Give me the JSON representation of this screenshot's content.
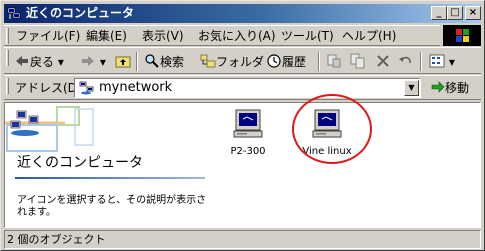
{
  "window": {
    "title": "近くのコンピュータ",
    "minimize": "_",
    "maximize": "□",
    "close": "×"
  },
  "menu": [
    {
      "label": "ファイル(F)"
    },
    {
      "label": "編集(E)"
    },
    {
      "label": "表示(V)"
    },
    {
      "label": "お気に入り(A)"
    },
    {
      "label": "ツール(T)"
    },
    {
      "label": "ヘルプ(H)"
    }
  ],
  "toolbar": {
    "back": "戻る",
    "search": "検索",
    "folders": "フォルダ",
    "history": "履歴"
  },
  "address": {
    "label": "アドレス(D)",
    "value": "mynetwork",
    "go": "移動"
  },
  "banner": {
    "title": "近くのコンピュータ",
    "description": "アイコンを選択すると、その説明が表示されます。"
  },
  "items": [
    {
      "label": "P2-300"
    },
    {
      "label": "Vine linux"
    }
  ],
  "status": {
    "text": "2 個のオブジェクト"
  },
  "colors": {
    "titlebar": "#0a246a",
    "chrome": "#d4d0c8",
    "highlight": "#e01818"
  }
}
